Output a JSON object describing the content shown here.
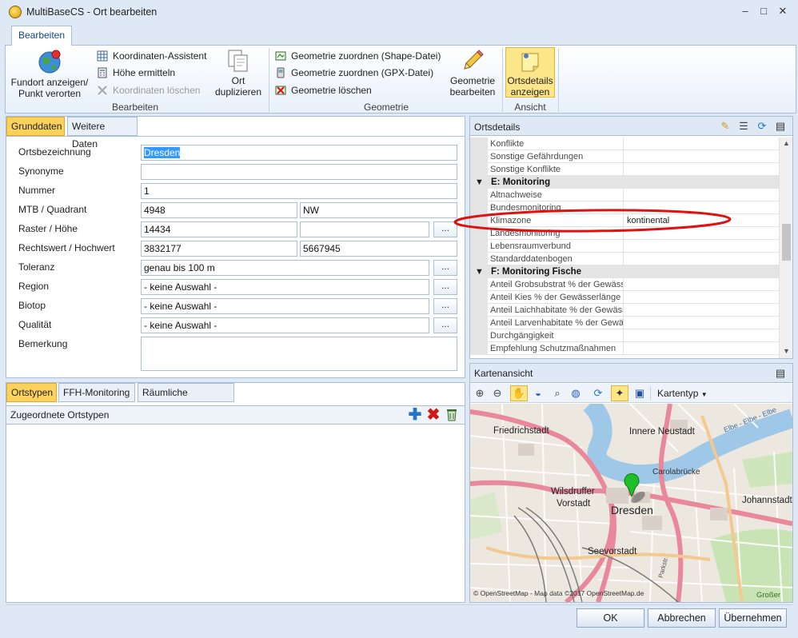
{
  "window": {
    "title": "MultiBaseCS - Ort bearbeiten",
    "buttons": [
      "–",
      "□",
      "✕"
    ]
  },
  "ribbon": {
    "tab": "Bearbeiten",
    "groups": {
      "bearbeiten": {
        "label": "Bearbeiten",
        "fundort_line1": "Fundort anzeigen/",
        "fundort_line2": "Punkt verorten",
        "koord_assistent": "Koordinaten-Assistent",
        "hoehe_ermitteln": "Höhe ermitteln",
        "koord_loeschen": "Koordinaten löschen",
        "ort_dup_line1": "Ort",
        "ort_dup_line2": "duplizieren"
      },
      "geometrie": {
        "label": "Geometrie",
        "shape": "Geometrie zuordnen (Shape-Datei)",
        "gpx": "Geometrie zuordnen (GPX-Datei)",
        "loeschen": "Geometrie löschen",
        "bearbeiten_line1": "Geometrie",
        "bearbeiten_line2": "bearbeiten"
      },
      "ansicht": {
        "label": "Ansicht",
        "ortsdetails_line1": "Ortsdetails",
        "ortsdetails_line2": "anzeigen"
      }
    }
  },
  "form": {
    "tabs": [
      "Grunddaten",
      "Weitere Daten"
    ],
    "labels": {
      "ortsbezeichnung": "Ortsbezeichnung",
      "synonyme": "Synonyme",
      "nummer": "Nummer",
      "mtb": "MTB / Quadrant",
      "raster": "Raster / Höhe",
      "rechtswert": "Rechtswert / Hochwert",
      "toleranz": "Toleranz",
      "region": "Region",
      "biotop": "Biotop",
      "qualitaet": "Qualität",
      "bemerkung": "Bemerkung"
    },
    "values": {
      "ortsbezeichnung": "Dresden",
      "synonyme": "",
      "nummer": "1",
      "mtb": "4948",
      "quadrant": "NW",
      "raster": "14434",
      "hoehe": "",
      "rechtswert": "3832177",
      "hochwert": "5667945",
      "toleranz": "genau bis 100 m",
      "region": "- keine Auswahl -",
      "biotop": "- keine Auswahl -",
      "qualitaet": "- keine Auswahl -",
      "bemerkung": ""
    },
    "dots": "..."
  },
  "lower": {
    "tabs": [
      "Ortstypen",
      "FFH-Monitoring",
      "Räumliche Einheiten"
    ],
    "header": "Zugeordnete Ortstypen"
  },
  "ortsdetails": {
    "title": "Ortsdetails",
    "rows": [
      {
        "type": "item",
        "name": "Konflikte",
        "value": ""
      },
      {
        "type": "item",
        "name": "Sonstige Gefährdungen",
        "value": ""
      },
      {
        "type": "item",
        "name": "Sonstige Konflikte",
        "value": ""
      },
      {
        "type": "cat",
        "name": "E:  Monitoring"
      },
      {
        "type": "item",
        "name": "Altnachweise",
        "value": ""
      },
      {
        "type": "item",
        "name": "Bundesmonitoring",
        "value": ""
      },
      {
        "type": "item",
        "name": "Klimazone",
        "value": "kontinental"
      },
      {
        "type": "item",
        "name": "Landesmonitoring",
        "value": ""
      },
      {
        "type": "item",
        "name": "Lebensraumverbund",
        "value": ""
      },
      {
        "type": "item",
        "name": "Standarddatenbogen",
        "value": ""
      },
      {
        "type": "cat",
        "name": "F:  Monitoring Fische"
      },
      {
        "type": "item",
        "name": "Anteil Grobsubstrat % der Gewässer",
        "value": ""
      },
      {
        "type": "item",
        "name": "Anteil Kies % der Gewässerlänge",
        "value": ""
      },
      {
        "type": "item",
        "name": "Anteil Laichhabitate % der Gewässe",
        "value": ""
      },
      {
        "type": "item",
        "name": "Anteil Larvenhabitate % der Gewäss",
        "value": ""
      },
      {
        "type": "item",
        "name": "Durchgängigkeit",
        "value": ""
      },
      {
        "type": "item",
        "name": "Empfehlung Schutzmaßnahmen",
        "value": ""
      }
    ]
  },
  "karte": {
    "title": "Kartenansicht",
    "kartentyp": "Kartentyp",
    "labels": {
      "friedrichstadt": "Friedrichstadt",
      "innere_neustadt": "Innere Neustadt",
      "carolabruecke": "Carolabrücke",
      "wilsdruffer1": "Wilsdruffer",
      "wilsdruffer2": "Vorstadt",
      "dresden": "Dresden",
      "johannstadt": "Johannstadt",
      "seevorstadt": "Seevorstadt",
      "elbe": "Elbe - Elbe - Elbe",
      "grosser": "Großer",
      "parkstr": "Parkstr.",
      "attribution": "© OpenStreetMap - Map data ©2017 OpenStreetMap.de"
    }
  },
  "footer": {
    "ok": "OK",
    "abbrechen": "Abbrechen",
    "uebernehmen": "Übernehmen"
  }
}
